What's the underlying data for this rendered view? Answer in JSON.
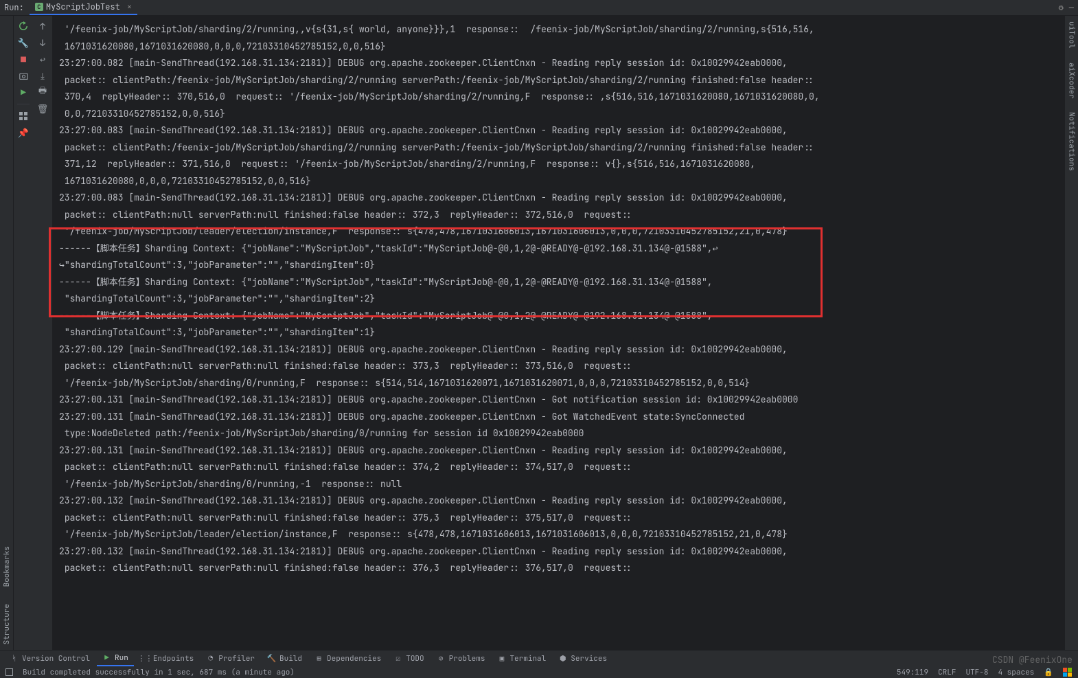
{
  "header": {
    "run_label": "Run:",
    "tab_title": "MyScriptJobTest",
    "tab_icon": "C"
  },
  "left": {
    "bookmarks": "Bookmarks",
    "structure": "Structure"
  },
  "right": {
    "uitool": "uiTool",
    "aixcoder": "aiXcoder",
    "notifications": "Notifications"
  },
  "console_lines": [
    " '/feenix-job/MyScriptJob/sharding/2/running,,v{s{31,s{ world, anyone}}},1  response::  /feenix-job/MyScriptJob/sharding/2/running,s{516,516,",
    " 1671031620080,1671031620080,0,0,0,72103310452785152,0,0,516}",
    "23:27:00.082 [main-SendThread(192.168.31.134:2181)] DEBUG org.apache.zookeeper.ClientCnxn - Reading reply session id: 0x10029942eab0000,",
    " packet:: clientPath:/feenix-job/MyScriptJob/sharding/2/running serverPath:/feenix-job/MyScriptJob/sharding/2/running finished:false header::",
    " 370,4  replyHeader:: 370,516,0  request:: '/feenix-job/MyScriptJob/sharding/2/running,F  response:: ,s{516,516,1671031620080,1671031620080,0,",
    " 0,0,72103310452785152,0,0,516}",
    "23:27:00.083 [main-SendThread(192.168.31.134:2181)] DEBUG org.apache.zookeeper.ClientCnxn - Reading reply session id: 0x10029942eab0000,",
    " packet:: clientPath:/feenix-job/MyScriptJob/sharding/2/running serverPath:/feenix-job/MyScriptJob/sharding/2/running finished:false header::",
    " 371,12  replyHeader:: 371,516,0  request:: '/feenix-job/MyScriptJob/sharding/2/running,F  response:: v{},s{516,516,1671031620080,",
    " 1671031620080,0,0,0,72103310452785152,0,0,516}",
    "23:27:00.083 [main-SendThread(192.168.31.134:2181)] DEBUG org.apache.zookeeper.ClientCnxn - Reading reply session id: 0x10029942eab0000,",
    " packet:: clientPath:null serverPath:null finished:false header:: 372,3  replyHeader:: 372,516,0  request::",
    " '/feenix-job/MyScriptJob/leader/election/instance,F  response:: s{478,478,1671031606013,1671031606013,0,0,0,72103310452785152,21,0,478}",
    "------【脚本任务】Sharding Context: {\"jobName\":\"MyScriptJob\",\"taskId\":\"MyScriptJob@-@0,1,2@-@READY@-@192.168.31.134@-@1588\",↩",
    "↪\"shardingTotalCount\":3,\"jobParameter\":\"\",\"shardingItem\":0}",
    "------【脚本任务】Sharding Context: {\"jobName\":\"MyScriptJob\",\"taskId\":\"MyScriptJob@-@0,1,2@-@READY@-@192.168.31.134@-@1588\",",
    " \"shardingTotalCount\":3,\"jobParameter\":\"\",\"shardingItem\":2}",
    "------【脚本任务】Sharding Context: {\"jobName\":\"MyScriptJob\",\"taskId\":\"MyScriptJob@-@0,1,2@-@READY@-@192.168.31.134@-@1588\",",
    " \"shardingTotalCount\":3,\"jobParameter\":\"\",\"shardingItem\":1}",
    "23:27:00.129 [main-SendThread(192.168.31.134:2181)] DEBUG org.apache.zookeeper.ClientCnxn - Reading reply session id: 0x10029942eab0000,",
    " packet:: clientPath:null serverPath:null finished:false header:: 373,3  replyHeader:: 373,516,0  request::",
    " '/feenix-job/MyScriptJob/sharding/0/running,F  response:: s{514,514,1671031620071,1671031620071,0,0,0,72103310452785152,0,0,514}",
    "23:27:00.131 [main-SendThread(192.168.31.134:2181)] DEBUG org.apache.zookeeper.ClientCnxn - Got notification session id: 0x10029942eab0000",
    "23:27:00.131 [main-SendThread(192.168.31.134:2181)] DEBUG org.apache.zookeeper.ClientCnxn - Got WatchedEvent state:SyncConnected",
    " type:NodeDeleted path:/feenix-job/MyScriptJob/sharding/0/running for session id 0x10029942eab0000",
    "23:27:00.131 [main-SendThread(192.168.31.134:2181)] DEBUG org.apache.zookeeper.ClientCnxn - Reading reply session id: 0x10029942eab0000,",
    " packet:: clientPath:null serverPath:null finished:false header:: 374,2  replyHeader:: 374,517,0  request::",
    " '/feenix-job/MyScriptJob/sharding/0/running,-1  response:: null",
    "23:27:00.132 [main-SendThread(192.168.31.134:2181)] DEBUG org.apache.zookeeper.ClientCnxn - Reading reply session id: 0x10029942eab0000,",
    " packet:: clientPath:null serverPath:null finished:false header:: 375,3  replyHeader:: 375,517,0  request::",
    " '/feenix-job/MyScriptJob/leader/election/instance,F  response:: s{478,478,1671031606013,1671031606013,0,0,0,72103310452785152,21,0,478}",
    "23:27:00.132 [main-SendThread(192.168.31.134:2181)] DEBUG org.apache.zookeeper.ClientCnxn - Reading reply session id: 0x10029942eab0000,",
    " packet:: clientPath:null serverPath:null finished:false header:: 376,3  replyHeader:: 376,517,0  request::"
  ],
  "bottom": {
    "vcs": "Version Control",
    "run": "Run",
    "endpoints": "Endpoints",
    "profiler": "Profiler",
    "build": "Build",
    "dependencies": "Dependencies",
    "todo": "TODO",
    "problems": "Problems",
    "terminal": "Terminal",
    "services": "Services"
  },
  "status": {
    "build_msg": "Build completed successfully in 1 sec, 687 ms (a minute ago)",
    "caret": "549:119",
    "eol": "CRLF",
    "enc": "UTF-8",
    "indent": "4 spaces"
  },
  "watermark": "CSDN @FeenixOne"
}
